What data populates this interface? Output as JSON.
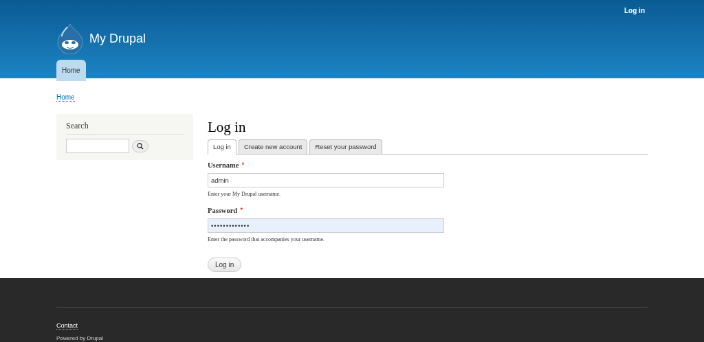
{
  "header": {
    "user_link": "Log in",
    "site_name": "My Drupal",
    "nav": [
      {
        "label": "Home",
        "selected": true
      }
    ]
  },
  "breadcrumb": [
    "Home"
  ],
  "sidebar": {
    "search": {
      "title": "Search"
    }
  },
  "main": {
    "title": "Log in",
    "tabs": [
      {
        "label": "Log in",
        "selected": true
      },
      {
        "label": "Create new account",
        "selected": false
      },
      {
        "label": "Reset your password",
        "selected": false
      }
    ],
    "fields": [
      {
        "label": "Username",
        "required_mark": "*",
        "value": "admin",
        "kind": "text",
        "focused": false,
        "help": "Enter your My Drupal username."
      },
      {
        "label": "Password",
        "required_mark": "*",
        "value": "•••••••••••••",
        "kind": "password",
        "focused": true,
        "help": "Enter the password that accompanies your username."
      }
    ],
    "submit": "Log in"
  },
  "footer": {
    "links": [
      "Contact"
    ],
    "powered": "Powered by Drupal"
  }
}
